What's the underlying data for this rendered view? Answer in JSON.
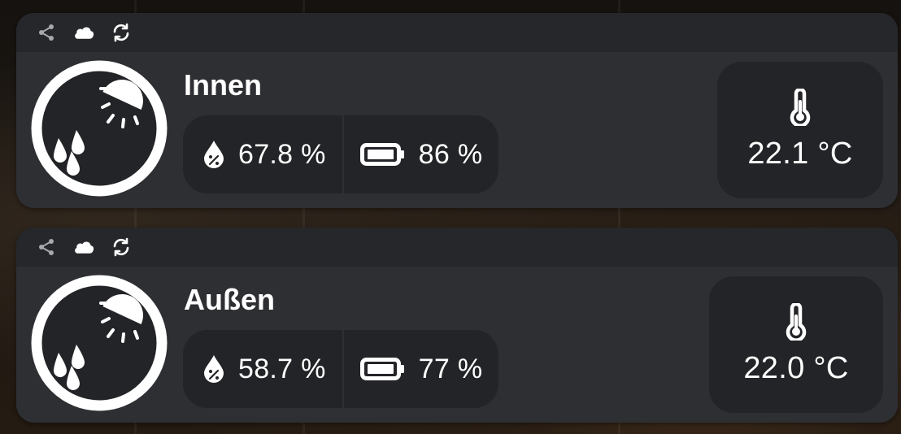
{
  "colors": {
    "card": "#2e2f33",
    "header": "#26272a",
    "pill": "#232427",
    "text": "#ffffff",
    "muted_icon": "#a8a9ad"
  },
  "sensors": [
    {
      "header_icons": [
        "share-icon",
        "cloud-icon",
        "refresh-icon"
      ],
      "emblem_icon": "weather-sun-rain-icon",
      "name": "Innen",
      "humidity": "67.8 %",
      "battery": "86 %",
      "temperature": "22.1 °C"
    },
    {
      "header_icons": [
        "share-icon",
        "cloud-icon",
        "refresh-icon"
      ],
      "emblem_icon": "weather-sun-rain-icon",
      "name": "Außen",
      "humidity": "58.7 %",
      "battery": "77 %",
      "temperature": "22.0 °C"
    }
  ]
}
